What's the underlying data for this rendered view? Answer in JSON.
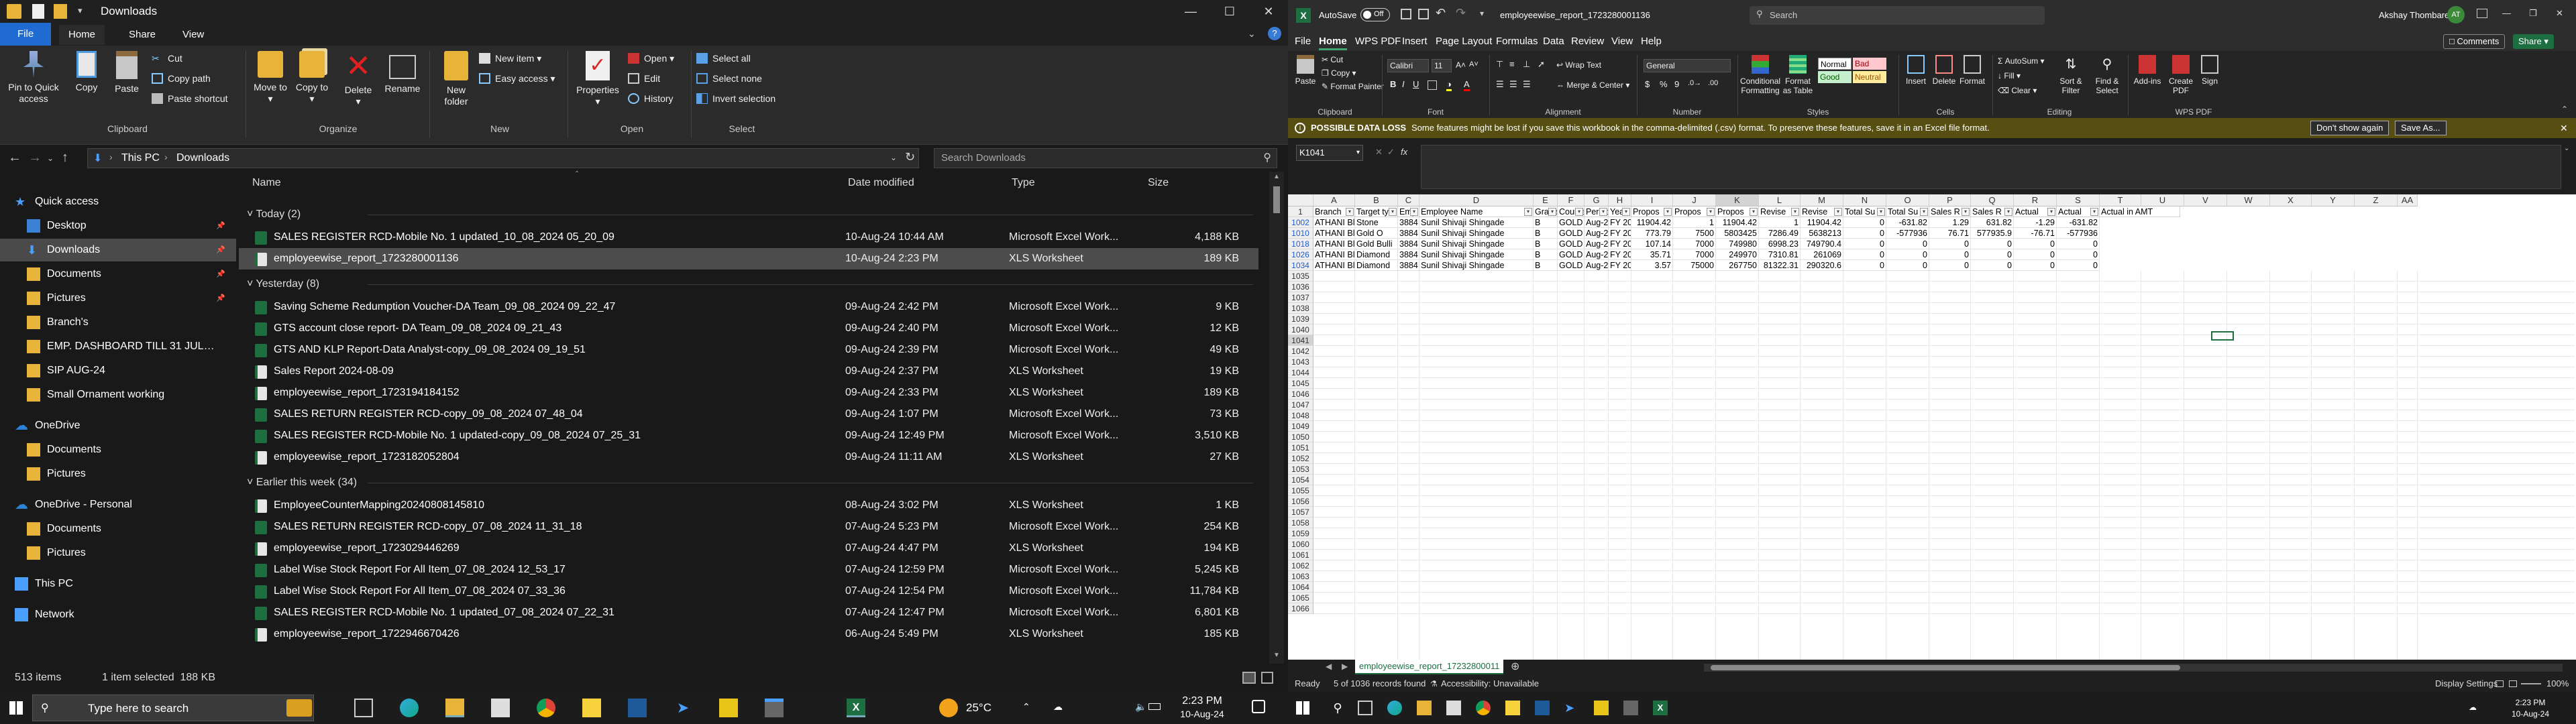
{
  "explorer": {
    "window_title": "Downloads",
    "tabs": [
      "File",
      "Home",
      "Share",
      "View"
    ],
    "ribbon": {
      "clipboard": {
        "pin": "Pin to Quick access",
        "copy": "Copy",
        "paste": "Paste",
        "cut": "Cut",
        "copy_path": "Copy path",
        "paste_shortcut": "Paste shortcut",
        "label": "Clipboard"
      },
      "organize": {
        "move_to": "Move to",
        "copy_to": "Copy to",
        "delete": "Delete",
        "rename": "Rename",
        "label": "Organize"
      },
      "new": {
        "new_folder": "New folder",
        "new_item": "New item",
        "easy_access": "Easy access",
        "label": "New"
      },
      "open": {
        "properties": "Properties",
        "open": "Open",
        "edit": "Edit",
        "history": "History",
        "label": "Open"
      },
      "select": {
        "select_all": "Select all",
        "select_none": "Select none",
        "invert": "Invert selection",
        "label": "Select"
      }
    },
    "address": {
      "crumb1": "This PC",
      "crumb2": "Downloads",
      "search_placeholder": "Search Downloads"
    },
    "nav": {
      "quick_access": "Quick access",
      "items": [
        "Desktop",
        "Downloads",
        "Documents",
        "Pictures",
        "Branch's",
        "EMP. DASHBOARD TILL 31 JUL-24",
        "SIP AUG-24",
        "Small Ornament working"
      ],
      "onedrive": "OneDrive",
      "onedrive_items": [
        "Documents",
        "Pictures"
      ],
      "onedrive_personal": "OneDrive - Personal",
      "odp_items": [
        "Documents",
        "Pictures"
      ],
      "this_pc": "This PC",
      "network": "Network"
    },
    "columns": {
      "name": "Name",
      "date": "Date modified",
      "type": "Type",
      "size": "Size"
    },
    "groups": [
      {
        "label": "Today (2)",
        "files": [
          {
            "name": "SALES REGISTER RCD-Mobile No. 1 updated_10_08_2024 05_20_09",
            "date": "10-Aug-24 10:44 AM",
            "type": "Microsoft Excel Work...",
            "size": "4,188 KB",
            "sel": false
          },
          {
            "name": "employeewise_report_1723280001136",
            "date": "10-Aug-24 2:23 PM",
            "type": "XLS Worksheet",
            "size": "189 KB",
            "sel": true
          }
        ]
      },
      {
        "label": "Yesterday (8)",
        "files": [
          {
            "name": "Saving Scheme Redumption Voucher-DA Team_09_08_2024 09_22_47",
            "date": "09-Aug-24 2:42 PM",
            "type": "Microsoft Excel Work...",
            "size": "9 KB",
            "sel": false
          },
          {
            "name": "GTS account close report- DA Team_09_08_2024 09_21_43",
            "date": "09-Aug-24 2:40 PM",
            "type": "Microsoft Excel Work...",
            "size": "12 KB",
            "sel": false
          },
          {
            "name": "GTS AND KLP Report-Data Analyst-copy_09_08_2024 09_19_51",
            "date": "09-Aug-24 2:39 PM",
            "type": "Microsoft Excel Work...",
            "size": "49 KB",
            "sel": false
          },
          {
            "name": "Sales Report 2024-08-09",
            "date": "09-Aug-24 2:37 PM",
            "type": "XLS Worksheet",
            "size": "19 KB",
            "sel": false
          },
          {
            "name": "employeewise_report_1723194184152",
            "date": "09-Aug-24 2:33 PM",
            "type": "XLS Worksheet",
            "size": "189 KB",
            "sel": false
          },
          {
            "name": "SALES RETURN REGISTER RCD-copy_09_08_2024 07_48_04",
            "date": "09-Aug-24 1:07 PM",
            "type": "Microsoft Excel Work...",
            "size": "73 KB",
            "sel": false
          },
          {
            "name": "SALES REGISTER RCD-Mobile No. 1 updated-copy_09_08_2024 07_25_31",
            "date": "09-Aug-24 12:49 PM",
            "type": "Microsoft Excel Work...",
            "size": "3,510 KB",
            "sel": false
          },
          {
            "name": "employeewise_report_1723182052804",
            "date": "09-Aug-24 11:11 AM",
            "type": "XLS Worksheet",
            "size": "27 KB",
            "sel": false
          }
        ]
      },
      {
        "label": "Earlier this week (34)",
        "files": [
          {
            "name": "EmployeeCounterMapping20240808145810",
            "date": "08-Aug-24 3:02 PM",
            "type": "XLS Worksheet",
            "size": "1 KB",
            "sel": false
          },
          {
            "name": "SALES RETURN REGISTER RCD-copy_07_08_2024 11_31_18",
            "date": "07-Aug-24 5:23 PM",
            "type": "Microsoft Excel Work...",
            "size": "254 KB",
            "sel": false
          },
          {
            "name": "employeewise_report_1723029446269",
            "date": "07-Aug-24 4:47 PM",
            "type": "XLS Worksheet",
            "size": "194 KB",
            "sel": false
          },
          {
            "name": "Label Wise Stock Report For All Item_07_08_2024 12_53_17",
            "date": "07-Aug-24 12:59 PM",
            "type": "Microsoft Excel Work...",
            "size": "5,245 KB",
            "sel": false
          },
          {
            "name": "Label Wise Stock Report For All Item_07_08_2024 07_33_36",
            "date": "07-Aug-24 12:54 PM",
            "type": "Microsoft Excel Work...",
            "size": "11,784 KB",
            "sel": false
          },
          {
            "name": "SALES REGISTER RCD-Mobile No. 1 updated_07_08_2024 07_22_31",
            "date": "07-Aug-24 12:47 PM",
            "type": "Microsoft Excel Work...",
            "size": "6,801 KB",
            "sel": false
          },
          {
            "name": "employeewise_report_1722946670426",
            "date": "06-Aug-24 5:49 PM",
            "type": "XLS Worksheet",
            "size": "185 KB",
            "sel": false
          }
        ]
      }
    ],
    "status": {
      "items": "513 items",
      "selected": "1 item selected  188 KB"
    }
  },
  "excel": {
    "autosave": "AutoSave",
    "toggle": "Off",
    "filename": "employeewise_report_1723280001136",
    "search": "Search",
    "user": "Akshay Thombare",
    "user_initials": "AT",
    "menu": [
      "File",
      "Home",
      "WPS PDF",
      "Insert",
      "Page Layout",
      "Formulas",
      "Data",
      "Review",
      "View",
      "Help"
    ],
    "comments": "Comments",
    "share": "Share",
    "ribbon": {
      "paste": "Paste",
      "cut": "Cut",
      "copy": "Copy",
      "format_painter": "Format Painter",
      "clipboard": "Clipboard",
      "font_name": "Calibri",
      "font_size": "11",
      "font": "Font",
      "wrap_text": "Wrap Text",
      "merge_center": "Merge & Center",
      "alignment": "Alignment",
      "number_format": "General",
      "number": "Number",
      "conditional": "Conditional Formatting",
      "format_table": "Format as Table",
      "style_normal": "Normal",
      "style_bad": "Bad",
      "style_good": "Good",
      "style_neutral": "Neutral",
      "styles": "Styles",
      "insert": "Insert",
      "delete": "Delete",
      "format": "Format",
      "cells": "Cells",
      "autosum": "AutoSum",
      "fill": "Fill",
      "clear": "Clear",
      "sort_filter": "Sort & Filter",
      "find_select": "Find & Select",
      "editing": "Editing",
      "addins": "Add-ins",
      "create_pdf": "Create PDF",
      "sign": "Sign",
      "wps_pdf": "WPS PDF"
    },
    "warning": {
      "title": "POSSIBLE DATA LOSS",
      "text": "Some features might be lost if you save this workbook in the comma-delimited (.csv) format. To preserve these features, save it in an Excel file format.",
      "dont_show": "Don't show again",
      "save_as": "Save As..."
    },
    "name_box": "K1041",
    "fx": "fx",
    "columns": [
      "A",
      "B",
      "C",
      "D",
      "E",
      "F",
      "G",
      "H",
      "I",
      "J",
      "K",
      "L",
      "M",
      "N",
      "O",
      "P",
      "Q",
      "R",
      "S",
      "T",
      "U",
      "V",
      "W",
      "X",
      "Y",
      "Z",
      "AA"
    ],
    "headers": [
      "Branch",
      "Target ty",
      "Employ",
      "Employee Name",
      "Grade",
      "Counte",
      "Period",
      "Year",
      "Propos",
      "Propos",
      "Propos",
      "Revise",
      "Revise",
      "Total Su",
      "Total Su",
      "Sales R",
      "Sales R",
      "Actual",
      "Actual",
      "Actual in AMT"
    ],
    "rows": [
      {
        "row": "1002",
        "cells": [
          "ATHANI Bl",
          "Stone",
          "3884",
          "Sunil Shivaji Shingade",
          "B",
          "GOLD ROT",
          "Aug-24",
          "FY 2024-25",
          "11904.42",
          "1",
          "11904.42",
          "1",
          "11904.42",
          "0",
          "-631.82",
          "1.29",
          "631.82",
          "-1.29",
          "-631.82"
        ]
      },
      {
        "row": "1010",
        "cells": [
          "ATHANI Bl",
          "Gold O",
          "3884",
          "Sunil Shivaji Shingade",
          "B",
          "GOLD ROT",
          "Aug-24",
          "FY 2024-25",
          "773.79",
          "7500",
          "5803425",
          "7286.49",
          "5638213",
          "0",
          "-577936",
          "76.71",
          "577935.9",
          "-76.71",
          "-577936"
        ]
      },
      {
        "row": "1018",
        "cells": [
          "ATHANI Bl",
          "Gold Bulli",
          "3884",
          "Sunil Shivaji Shingade",
          "B",
          "GOLD ROT",
          "Aug-24",
          "FY 2024-25",
          "107.14",
          "7000",
          "749980",
          "6998.23",
          "749790.4",
          "0",
          "0",
          "0",
          "0",
          "0",
          "0"
        ]
      },
      {
        "row": "1026",
        "cells": [
          "ATHANI Bl",
          "Diamond",
          "3884",
          "Sunil Shivaji Shingade",
          "B",
          "GOLD ROT",
          "Aug-24",
          "FY 2024-25",
          "35.71",
          "7000",
          "249970",
          "7310.81",
          "261069",
          "0",
          "0",
          "0",
          "0",
          "0",
          "0"
        ]
      },
      {
        "row": "1034",
        "cells": [
          "ATHANI Bl",
          "Diamond",
          "3884",
          "Sunil Shivaji Shingade",
          "B",
          "GOLD ROT",
          "Aug-24",
          "FY 2024-25",
          "3.57",
          "75000",
          "267750",
          "81322.31",
          "290320.6",
          "0",
          "0",
          "0",
          "0",
          "0",
          "0"
        ]
      }
    ],
    "row_numbers": [
      "1",
      "1002",
      "1010",
      "1018",
      "1026",
      "1034",
      "1035",
      "1036",
      "1037",
      "1038",
      "1039",
      "1040",
      "1041",
      "1042",
      "1043",
      "1044",
      "1045",
      "1046",
      "1047",
      "1048",
      "1049",
      "1050",
      "1051",
      "1052",
      "1053",
      "1054",
      "1055",
      "1056",
      "1057",
      "1058",
      "1059",
      "1060",
      "1061",
      "1062",
      "1063",
      "1064",
      "1065",
      "1066"
    ],
    "sheet_tab": "employeewise_report_17232800011",
    "status": {
      "ready": "Ready",
      "records": "5 of 1036 records found",
      "accessibility": "Accessibility: Unavailable",
      "display": "Display Settings",
      "zoom": "100%"
    }
  },
  "taskbar": {
    "search_placeholder": "Type here to search",
    "weather": "25°C",
    "time": "2:23 PM",
    "date": "10-Aug-24",
    "time2": "2:23 PM",
    "date2": "10-Aug-24"
  },
  "colors": {
    "excel_green": "#1d6f42",
    "warn": "#574e12",
    "selection": "#4c4c4c"
  }
}
